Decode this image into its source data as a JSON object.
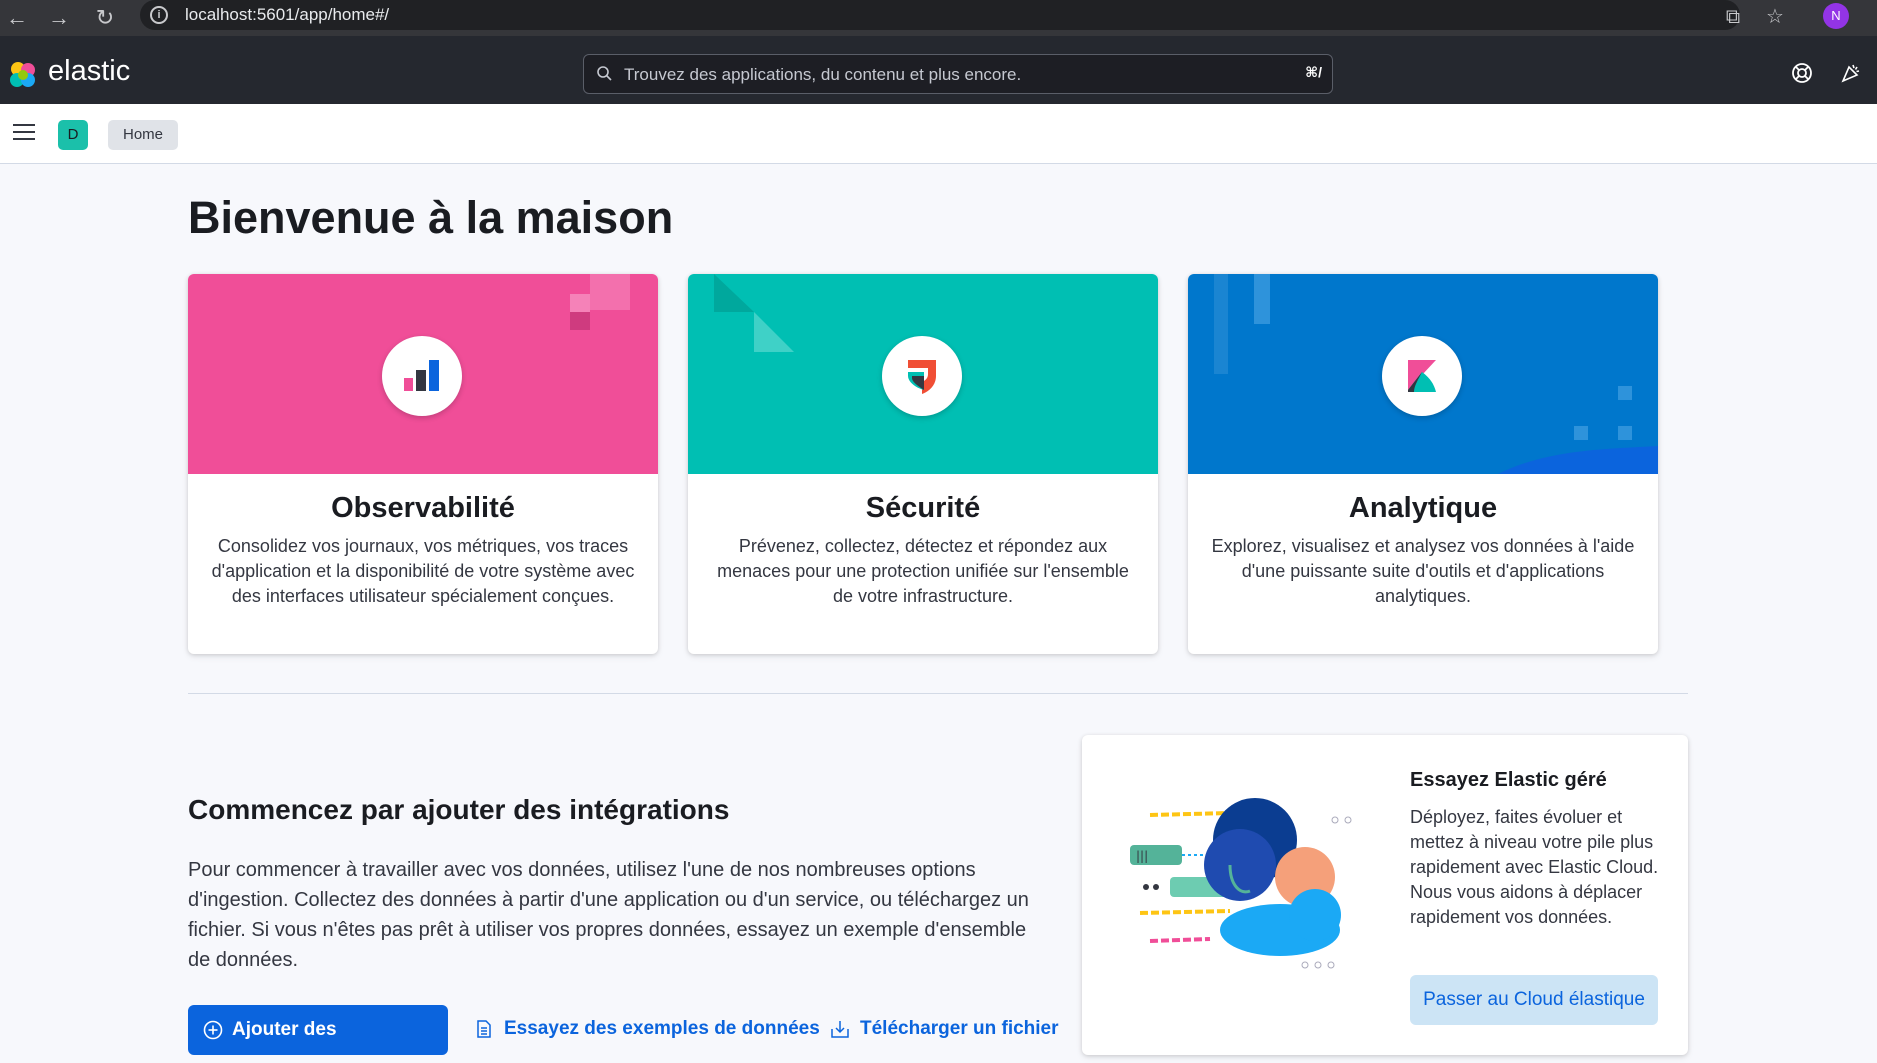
{
  "browser": {
    "url": "localhost:5601/app/home#/",
    "profile_initial": "N"
  },
  "header": {
    "brand": "elastic",
    "search_placeholder": "Trouvez des applications, du contenu et plus encore.",
    "search_shortcut": "⌘/"
  },
  "subheader": {
    "space_initial": "D",
    "breadcrumb": "Home"
  },
  "page": {
    "title": "Bienvenue à la maison"
  },
  "solutions": [
    {
      "title": "Observabilité",
      "description": "Consolidez vos journaux, vos métriques, vos traces d'application et la disponibilité de votre système avec des interfaces utilisateur spécialement conçues.",
      "color": "#f04e98"
    },
    {
      "title": "Sécurité",
      "description": "Prévenez, collectez, détectez et répondez aux menaces pour une protection unifiée sur l'ensemble de votre infrastructure.",
      "color": "#00bfb3"
    },
    {
      "title": "Analytique",
      "description": "Explorez, visualisez et analysez vos données à l'aide d'une puissante suite d'outils et d'applications analytiques.",
      "color": "#0077cc"
    }
  ],
  "integrations": {
    "title": "Commencez par ajouter des intégrations",
    "description": "Pour commencer à travailler avec vos données, utilisez l'une de nos nombreuses options d'ingestion. Collectez des données à partir d'une application ou d'un service, ou téléchargez un fichier. Si vous n'êtes pas prêt à utiliser vos propres données, essayez un exemple d'ensemble de données.",
    "add_button": "Ajouter des intégrations",
    "sample_link": "Essayez des exemples de données",
    "upload_link": "Télécharger un fichier"
  },
  "cloud": {
    "title": "Essayez Elastic géré",
    "description": "Déployez, faites évoluer et mettez à niveau votre pile plus rapidement avec Elastic Cloud. Nous vous aidons à déplacer rapidement vos données.",
    "button": "Passer au Cloud élastique"
  }
}
